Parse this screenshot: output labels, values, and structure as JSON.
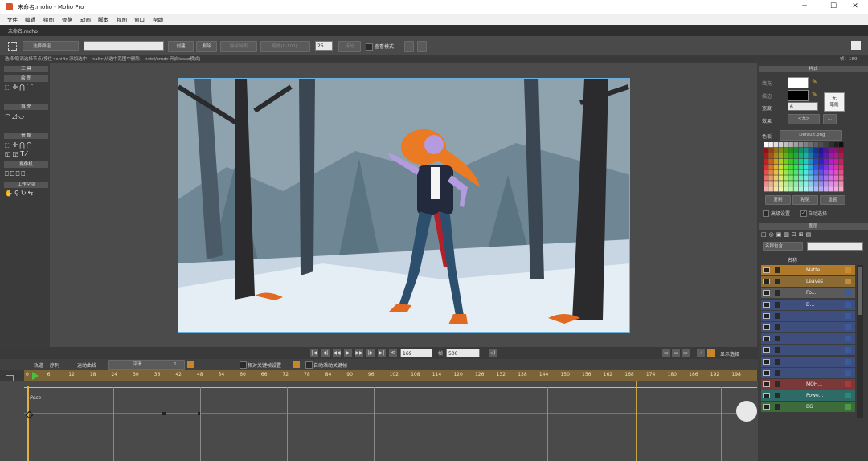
{
  "window": {
    "title": "未命名.moho - Moho Pro",
    "minimize": "─",
    "maximize": "☐",
    "close": "✕"
  },
  "menu": [
    "文件",
    "编辑",
    "绘图",
    "骨骼",
    "动画",
    "脚本",
    "视图",
    "窗口",
    "帮助"
  ],
  "document_tab": "未命名.moho",
  "toolbar": {
    "select_group": "选择群组",
    "create": "创建",
    "delete": "删除",
    "disabled1": "除绘制面",
    "disabled2": "缩放(0-100):",
    "value": "25",
    "disabled3": "拆分",
    "view_mode": "查看模式"
  },
  "status": {
    "left": "选择/取消选择节点(按住<shift>添加选中，<alt>从选中范围中删除，<ctrl/cmd>开启lasso模式)",
    "right": "帧：169"
  },
  "tools": {
    "title": "工 具",
    "sections": [
      "绘 图",
      "填 充",
      "骨 骼",
      "摄像机",
      "工作空间"
    ]
  },
  "playback": {
    "current_frame": "169",
    "end_label": "帧",
    "end_frame": "500",
    "show_all": "显示选择"
  },
  "timeline": {
    "tabs": [
      "轨道",
      "序列",
      "运动曲线"
    ],
    "interp": "平滑",
    "step": "1",
    "relative_keys": "相对关键帧设置",
    "auto_keys": "自动活动关键帧",
    "ticks": [
      "0",
      "6",
      "12",
      "18",
      "24",
      "30",
      "36",
      "42",
      "48",
      "54",
      "60",
      "66",
      "72",
      "78",
      "84",
      "90",
      "96",
      "102",
      "108",
      "114",
      "120",
      "126",
      "132",
      "138",
      "144",
      "150",
      "156",
      "162",
      "168",
      "174",
      "180",
      "186",
      "192",
      "198"
    ],
    "row_label": "Pose"
  },
  "style_panel": {
    "title": "样式",
    "fill": "填充",
    "stroke": "描边",
    "width_label": "宽度",
    "width_value": "6",
    "effect_label": "效果",
    "effect_value": "<无>",
    "no_brush": "无\n笔刷",
    "palette_label": "色板",
    "palette_value": "_Default.png",
    "copy": "复制",
    "paste": "粘贴",
    "reset": "重置",
    "advanced": "高级设置",
    "auto_select": "自动选择"
  },
  "layers_panel": {
    "title": "图层",
    "filter": "名称包含...",
    "col_name": "名称",
    "layers": [
      {
        "name": "Matte",
        "color": "#c98b2b",
        "bg": "#b07a2a"
      },
      {
        "name": "Leaves",
        "color": "#c98b2b",
        "bg": "#8a6a35"
      },
      {
        "name": "Fo...",
        "color": "#3a5a9a",
        "bg": "#5a5a5a"
      },
      {
        "name": "D...",
        "color": "#3a5a9a",
        "bg": "#3e4f7e"
      },
      {
        "name": "",
        "color": "#3a5a9a",
        "bg": "#3e4f7e"
      },
      {
        "name": "",
        "color": "#3a5a9a",
        "bg": "#3e4f7e"
      },
      {
        "name": "",
        "color": "#3a5a9a",
        "bg": "#3e4f7e"
      },
      {
        "name": "",
        "color": "#3a5a9a",
        "bg": "#3e4f7e"
      },
      {
        "name": "",
        "color": "#3a5a9a",
        "bg": "#3e4f7e"
      },
      {
        "name": "",
        "color": "#3a5a9a",
        "bg": "#3e4f7e"
      },
      {
        "name": "MOH...",
        "color": "#a83a3a",
        "bg": "#7a3838"
      },
      {
        "name": "Powe...",
        "color": "#2a8a7a",
        "bg": "#2f6b66"
      },
      {
        "name": "BG",
        "color": "#4a9a4a",
        "bg": "#3d6b3a"
      }
    ]
  }
}
